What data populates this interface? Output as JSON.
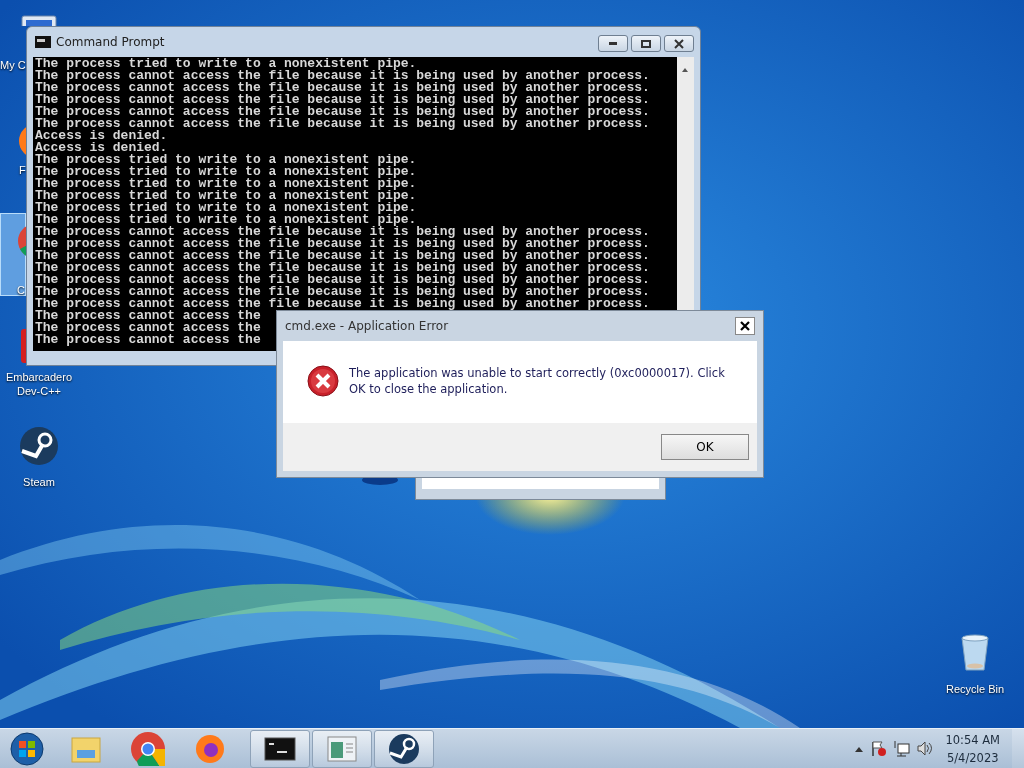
{
  "desktop_icons": [
    {
      "kind": "computer",
      "label": "My C",
      "selected": false
    },
    {
      "kind": "firefox",
      "label": "F",
      "selected": false
    },
    {
      "kind": "chrome",
      "label": "C",
      "selected": true
    },
    {
      "kind": "devcpp",
      "label": "Embarcadero Dev-C++",
      "selected": false
    },
    {
      "kind": "steam",
      "label": "Steam",
      "selected": false
    },
    {
      "kind": "recycle",
      "label": "Recycle Bin",
      "selected": false
    }
  ],
  "console_window": {
    "title": "Command Prompt",
    "lines": [
      "The process tried to write to a nonexistent pipe.",
      "The process cannot access the file because it is being used by another process.",
      "The process cannot access the file because it is being used by another process.",
      "The process cannot access the file because it is being used by another process.",
      "The process cannot access the file because it is being used by another process.",
      "The process cannot access the file because it is being used by another process.",
      "Access is denied.",
      "Access is denied.",
      "The process tried to write to a nonexistent pipe.",
      "The process tried to write to a nonexistent pipe.",
      "The process tried to write to a nonexistent pipe.",
      "The process tried to write to a nonexistent pipe.",
      "The process tried to write to a nonexistent pipe.",
      "The process tried to write to a nonexistent pipe.",
      "The process cannot access the file because it is being used by another process.",
      "The process cannot access the file because it is being used by another process.",
      "The process cannot access the file because it is being used by another process.",
      "The process cannot access the file because it is being used by another process.",
      "The process cannot access the file because it is being used by another process.",
      "The process cannot access the file because it is being used by another process.",
      "The process cannot access the file because it is being used by another process.",
      "The process cannot access the",
      "The process cannot access the",
      "The process cannot access the"
    ]
  },
  "dialog": {
    "title": "cmd.exe - Application Error",
    "message": "The application was unable to start correctly (0xc0000017). Click OK to close the application.",
    "button": "OK"
  },
  "taskbar": {
    "items": [
      {
        "kind": "start",
        "running": false
      },
      {
        "kind": "explorer",
        "running": false
      },
      {
        "kind": "chrome",
        "running": false
      },
      {
        "kind": "firefox",
        "running": false
      },
      {
        "kind": "cmd",
        "running": true
      },
      {
        "kind": "app",
        "running": true
      },
      {
        "kind": "steam",
        "running": true
      }
    ],
    "time": "10:54 AM",
    "date": "5/4/2023"
  }
}
